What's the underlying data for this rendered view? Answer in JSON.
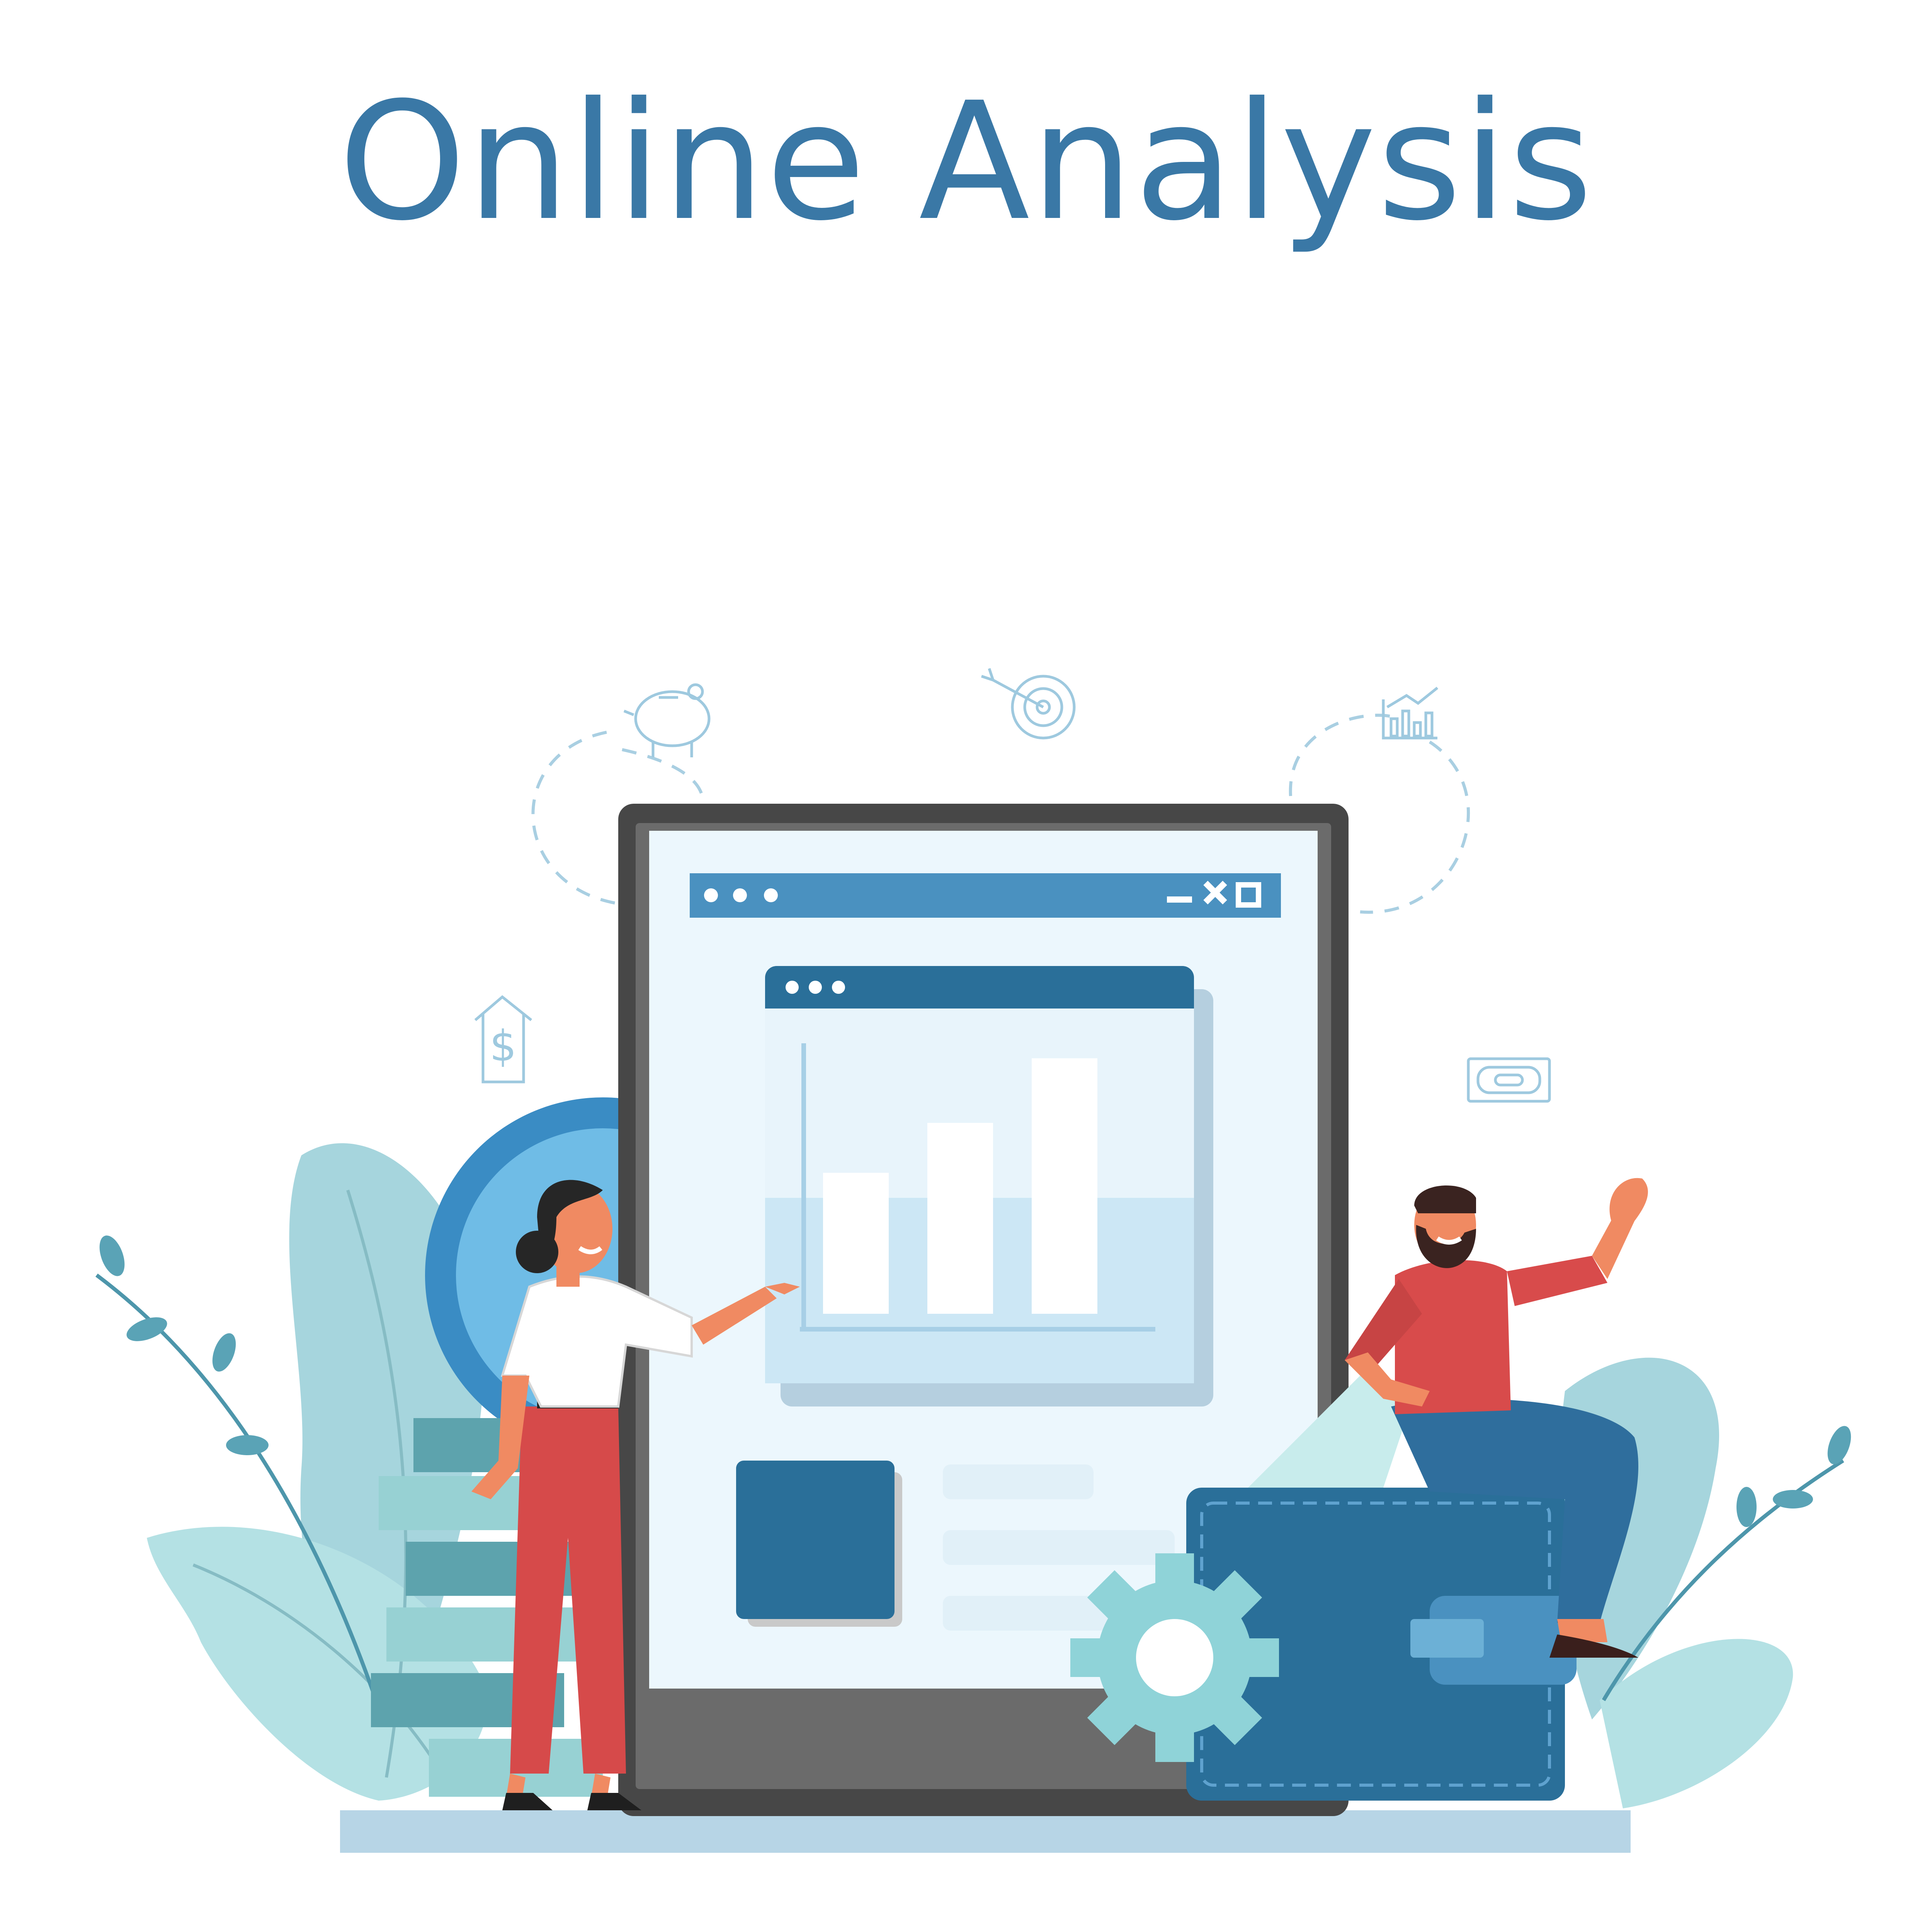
{
  "header": {
    "title": "Online Analysis"
  },
  "colors": {
    "title": "#3a78a6",
    "device_frame": "#474747",
    "screen_bg": "#ecf7fd",
    "window_bar": "#4a91c0",
    "chart_window_bar": "#2a6f99",
    "chart_bg": "#cfe9f6",
    "dark_tile": "#2a6f99",
    "placeholder_line": "#e1f0f8",
    "leaf_light": "#a9dbe0",
    "leaf_mid": "#8fc9cf",
    "wallet": "#2a6f99",
    "gear": "#8fd3d8",
    "woman_pants": "#d64a4a",
    "man_shirt": "#d84b4b",
    "man_jeans": "#2f6e9d",
    "floor": "#b7d5e6"
  },
  "icons": {
    "floating": [
      "piggy-bank-icon",
      "target-icon",
      "growth-chart-icon",
      "house-dollar-icon",
      "banknote-icon"
    ],
    "window_controls": [
      "minimize-icon",
      "close-icon",
      "maximize-icon"
    ]
  },
  "chart_data": {
    "type": "bar",
    "categories": [
      "",
      "",
      ""
    ],
    "values": [
      0.48,
      0.65,
      0.87
    ],
    "title": "",
    "xlabel": "",
    "ylabel": "",
    "ylim": [
      0,
      1
    ],
    "grid": false
  }
}
